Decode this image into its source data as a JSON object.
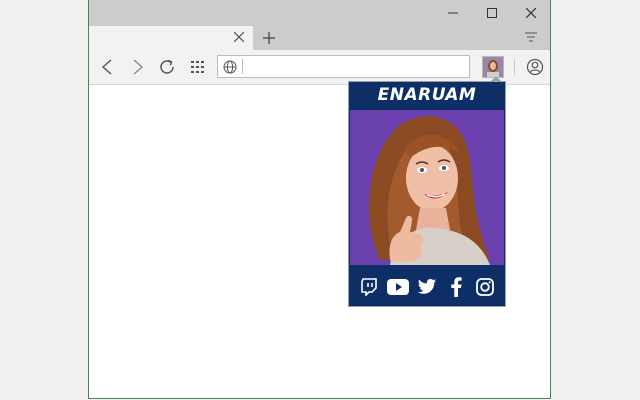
{
  "browser": {
    "address_bar": {
      "value": "",
      "placeholder": ""
    },
    "tab": {
      "title": ""
    }
  },
  "popup": {
    "title": "ENARUAM",
    "social": [
      "twitch-icon",
      "youtube-icon",
      "twitter-icon",
      "facebook-icon",
      "instagram-icon"
    ]
  },
  "colors": {
    "popup_bg": "#0d2f66",
    "photo_bg": "#6a3fae",
    "chrome_gray": "#cccccc",
    "window_border": "#3d8a4e"
  }
}
